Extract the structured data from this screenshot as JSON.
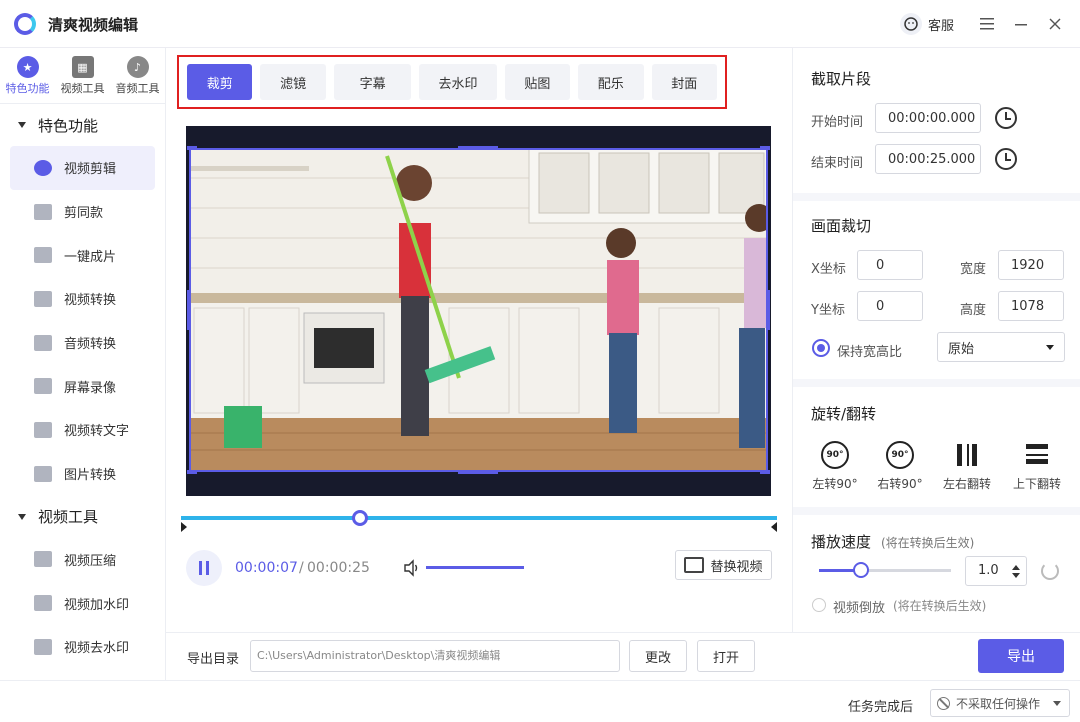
{
  "app": {
    "title": "清爽视频编辑"
  },
  "titlebar": {
    "service_label": "客服"
  },
  "sidebar": {
    "top_tabs": [
      {
        "label": "特色功能",
        "icon": "star-icon"
      },
      {
        "label": "视频工具",
        "icon": "film-icon"
      },
      {
        "label": "音频工具",
        "icon": "audio-icon"
      }
    ],
    "sections": [
      {
        "title": "特色功能",
        "items": [
          "视频剪辑",
          "剪同款",
          "一键成片",
          "视频转换",
          "音频转换",
          "屏幕录像",
          "视频转文字",
          "图片转换"
        ]
      },
      {
        "title": "视频工具",
        "items": [
          "视频压缩",
          "视频加水印",
          "视频去水印"
        ]
      }
    ]
  },
  "tool_tabs": [
    "裁剪",
    "滤镜",
    "字幕",
    "去水印",
    "贴图",
    "配乐",
    "封面"
  ],
  "player": {
    "current_time": "00:00:07",
    "separator": "/",
    "total_time": "00:00:25",
    "progress": 0.3,
    "replace_label": "替换视频"
  },
  "export": {
    "label": "导出目录",
    "path": "C:\\Users\\Administrator\\Desktop\\清爽视频编辑",
    "change_label": "更改",
    "open_label": "打开",
    "export_label": "导出"
  },
  "right_panel": {
    "clip": {
      "title": "截取片段",
      "start_label": "开始时间",
      "start_value": "00:00:00.000",
      "end_label": "结束时间",
      "end_value": "00:00:25.000"
    },
    "crop": {
      "title": "画面裁切",
      "x_label": "X坐标",
      "x_value": "0",
      "y_label": "Y坐标",
      "y_value": "0",
      "width_label": "宽度",
      "width_value": "1920",
      "height_label": "高度",
      "height_value": "1078",
      "keep_ratio_label": "保持宽高比",
      "ratio_value": "原始"
    },
    "rotate": {
      "title": "旋转/翻转",
      "buttons": [
        {
          "label": "左转90°",
          "icon_text": "90°"
        },
        {
          "label": "右转90°",
          "icon_text": "90°"
        },
        {
          "label": "左右翻转"
        },
        {
          "label": "上下翻转"
        }
      ]
    },
    "speed": {
      "title": "播放速度",
      "note": "(将在转换后生效)",
      "value": "1.0",
      "reverse_label": "视频倒放",
      "reverse_note": "(将在转换后生效)"
    }
  },
  "statusbar": {
    "label": "任务完成后",
    "select_value": "不采取任何操作"
  },
  "colors": {
    "accent": "#5b5ce6",
    "timeline": "#2eb3ea",
    "highlight_border": "#e02020"
  }
}
